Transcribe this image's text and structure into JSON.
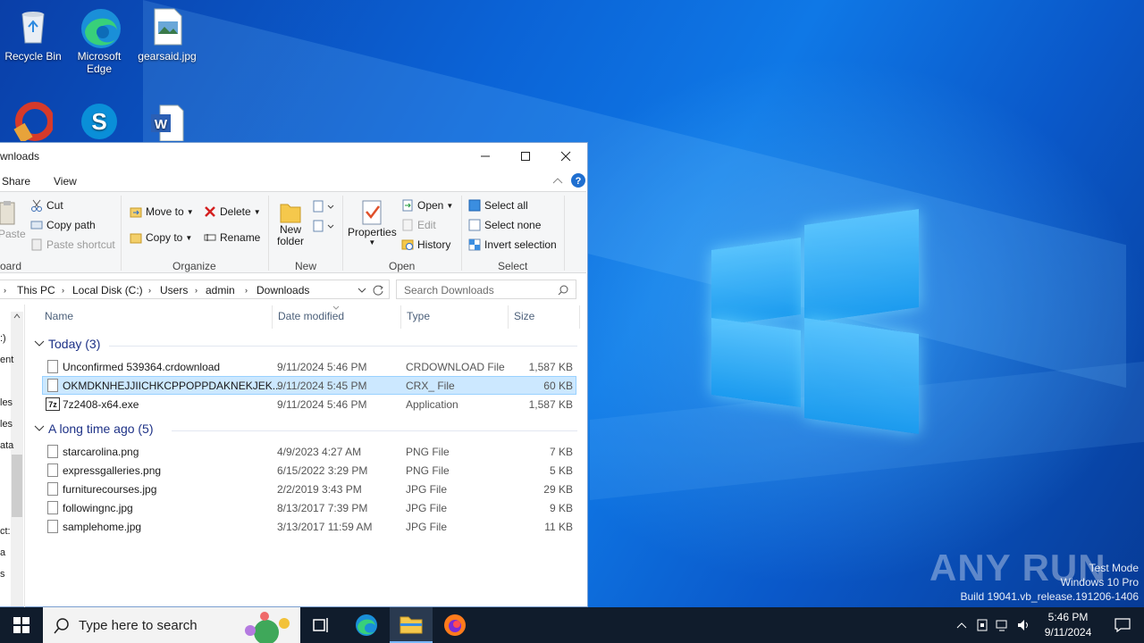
{
  "desktop": {
    "icons": [
      {
        "label": "Recycle Bin",
        "icon": "recycle-bin-icon"
      },
      {
        "label": "Microsoft Edge",
        "icon": "edge-icon"
      },
      {
        "label": "gearsaid.jpg",
        "icon": "image-file-icon"
      },
      {
        "label": "",
        "icon": "ccleaner-icon"
      },
      {
        "label": "",
        "icon": "skype-icon"
      },
      {
        "label": "",
        "icon": "word-document-icon"
      }
    ],
    "watermark": {
      "line1": "Test Mode",
      "line2": "Windows 10 Pro",
      "line3": "Build 19041.vb_release.191206-1406"
    },
    "brand": "ANY RUN"
  },
  "explorer": {
    "title": "wnloads",
    "tabs": {
      "share": "Share",
      "view": "View"
    },
    "ribbon": {
      "clipboard": {
        "paste": "Paste",
        "cut": "Cut",
        "copy_path": "Copy path",
        "paste_shortcut": "Paste shortcut",
        "label": "oard"
      },
      "organize": {
        "move_to": "Move to",
        "copy_to": "Copy to",
        "delete": "Delete",
        "rename": "Rename",
        "label": "Organize"
      },
      "new": {
        "new_folder_1": "New",
        "new_folder_2": "folder",
        "label": "New"
      },
      "open": {
        "properties": "Properties",
        "open": "Open",
        "edit": "Edit",
        "history": "History",
        "label": "Open"
      },
      "select": {
        "select_all": "Select all",
        "select_none": "Select none",
        "invert": "Invert selection",
        "label": "Select"
      }
    },
    "address": {
      "crumbs": [
        "This PC",
        "Local Disk (C:)",
        "Users",
        "admin",
        "Downloads"
      ],
      "search_placeholder": "Search Downloads"
    },
    "nav_fragments": [
      ":)",
      "ent",
      "les",
      "les",
      "ata",
      "ct:",
      "a",
      "s"
    ],
    "columns": {
      "name": "Name",
      "date": "Date modified",
      "type": "Type",
      "size": "Size"
    },
    "groups": [
      {
        "label": "Today (3)",
        "files": [
          {
            "name": "Unconfirmed 539364.crdownload",
            "date": "9/11/2024 5:46 PM",
            "type": "CRDOWNLOAD File",
            "size": "1,587 KB",
            "selected": false
          },
          {
            "name": "OKMDKNHEJJIICHKCPPOPPDAKNEKJEK...",
            "date": "9/11/2024 5:45 PM",
            "type": "CRX_ File",
            "size": "60 KB",
            "selected": true
          },
          {
            "name": "7z2408-x64.exe",
            "date": "9/11/2024 5:46 PM",
            "type": "Application",
            "size": "1,587 KB",
            "selected": false
          }
        ]
      },
      {
        "label": "A long time ago (5)",
        "files": [
          {
            "name": "starcarolina.png",
            "date": "4/9/2023 4:27 AM",
            "type": "PNG File",
            "size": "7 KB",
            "selected": false
          },
          {
            "name": "expressgalleries.png",
            "date": "6/15/2022 3:29 PM",
            "type": "PNG File",
            "size": "5 KB",
            "selected": false
          },
          {
            "name": "furniturecourses.jpg",
            "date": "2/2/2019 3:43 PM",
            "type": "JPG File",
            "size": "29 KB",
            "selected": false
          },
          {
            "name": "followingnc.jpg",
            "date": "8/13/2017 7:39 PM",
            "type": "JPG File",
            "size": "9 KB",
            "selected": false
          },
          {
            "name": "samplehome.jpg",
            "date": "3/13/2017 11:59 AM",
            "type": "JPG File",
            "size": "11 KB",
            "selected": false
          }
        ]
      }
    ]
  },
  "taskbar": {
    "search_placeholder": "Type here to search",
    "time": "5:46 PM",
    "date": "9/11/2024"
  }
}
